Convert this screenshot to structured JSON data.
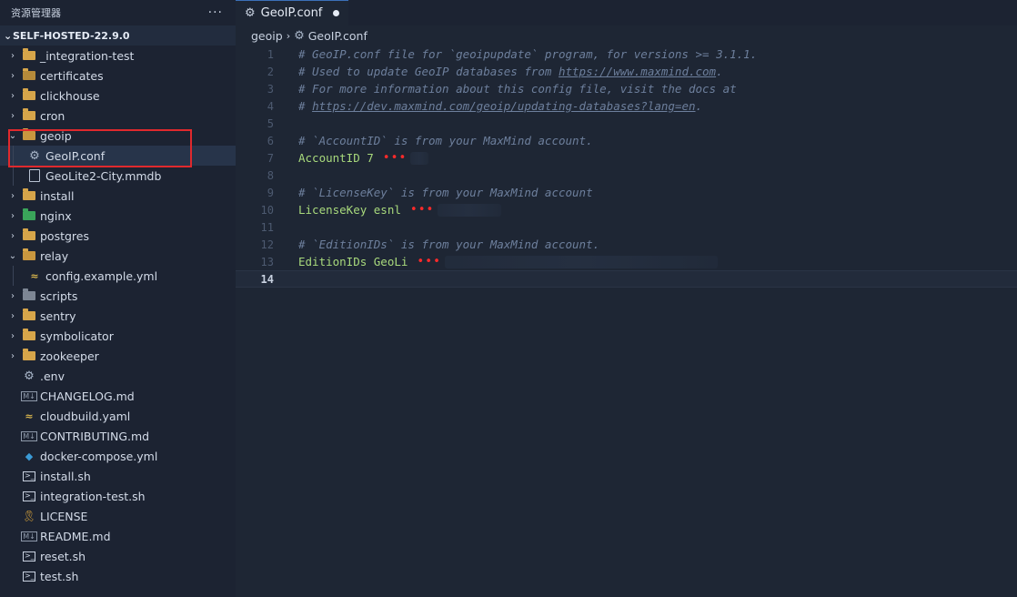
{
  "sidebar": {
    "title": "资源管理器",
    "more": "···",
    "root": "SELF-HOSTED-22.9.0",
    "items": [
      {
        "label": "_integration-test",
        "type": "folder",
        "depth": 0,
        "chev": "›"
      },
      {
        "label": "certificates",
        "type": "folder-cert",
        "depth": 0,
        "chev": "›"
      },
      {
        "label": "clickhouse",
        "type": "folder",
        "depth": 0,
        "chev": "›"
      },
      {
        "label": "cron",
        "type": "folder",
        "depth": 0,
        "chev": "›"
      },
      {
        "label": "geoip",
        "type": "folder-open",
        "depth": 0,
        "chev": "⌄"
      },
      {
        "label": "GeoIP.conf",
        "type": "gear",
        "depth": 1,
        "chev": ""
      },
      {
        "label": "GeoLite2-City.mmdb",
        "type": "doc",
        "depth": 1,
        "chev": ""
      },
      {
        "label": "install",
        "type": "folder",
        "depth": 0,
        "chev": "›"
      },
      {
        "label": "nginx",
        "type": "folder-nginx",
        "depth": 0,
        "chev": "›"
      },
      {
        "label": "postgres",
        "type": "folder",
        "depth": 0,
        "chev": "›"
      },
      {
        "label": "relay",
        "type": "folder-open",
        "depth": 0,
        "chev": "⌄"
      },
      {
        "label": "config.example.yml",
        "type": "yml",
        "depth": 1,
        "chev": ""
      },
      {
        "label": "scripts",
        "type": "folder-scripts",
        "depth": 0,
        "chev": "›"
      },
      {
        "label": "sentry",
        "type": "folder",
        "depth": 0,
        "chev": "›"
      },
      {
        "label": "symbolicator",
        "type": "folder",
        "depth": 0,
        "chev": "›"
      },
      {
        "label": "zookeeper",
        "type": "folder",
        "depth": 0,
        "chev": "›"
      },
      {
        "label": ".env",
        "type": "gear",
        "depth": 0,
        "chev": ""
      },
      {
        "label": "CHANGELOG.md",
        "type": "md",
        "depth": 0,
        "chev": ""
      },
      {
        "label": "cloudbuild.yaml",
        "type": "yml",
        "depth": 0,
        "chev": ""
      },
      {
        "label": "CONTRIBUTING.md",
        "type": "md",
        "depth": 0,
        "chev": ""
      },
      {
        "label": "docker-compose.yml",
        "type": "docker",
        "depth": 0,
        "chev": ""
      },
      {
        "label": "install.sh",
        "type": "sh",
        "depth": 0,
        "chev": ""
      },
      {
        "label": "integration-test.sh",
        "type": "sh",
        "depth": 0,
        "chev": ""
      },
      {
        "label": "LICENSE",
        "type": "license",
        "depth": 0,
        "chev": ""
      },
      {
        "label": "README.md",
        "type": "md",
        "depth": 0,
        "chev": ""
      },
      {
        "label": "reset.sh",
        "type": "sh",
        "depth": 0,
        "chev": ""
      },
      {
        "label": "test.sh",
        "type": "sh",
        "depth": 0,
        "chev": ""
      }
    ],
    "selected_index": 5
  },
  "editor": {
    "tab": {
      "label": "GeoIP.conf",
      "modified": true
    },
    "breadcrumb": {
      "folder": "geoip",
      "separator": "›",
      "file": "GeoIP.conf"
    },
    "current_line": 14,
    "lines": [
      {
        "n": "1",
        "kind": "comment",
        "text": "# GeoIP.conf file for `geoipupdate` program, for versions >= 3.1.1."
      },
      {
        "n": "2",
        "kind": "comment-link",
        "pre": "# Used to update GeoIP databases from ",
        "link": "https://www.maxmind.com",
        "post": "."
      },
      {
        "n": "3",
        "kind": "comment",
        "text": "# For more information about this config file, visit the docs at"
      },
      {
        "n": "4",
        "kind": "comment-link",
        "pre": "# ",
        "link": "https://dev.maxmind.com/geoip/updating-databases?lang=en",
        "post": "."
      },
      {
        "n": "5",
        "kind": "blank",
        "text": ""
      },
      {
        "n": "6",
        "kind": "comment",
        "text": "# `AccountID` is from your MaxMind account."
      },
      {
        "n": "7",
        "kind": "value",
        "text": "AccountID 7",
        "redacted": "•••"
      },
      {
        "n": "8",
        "kind": "blank",
        "text": ""
      },
      {
        "n": "9",
        "kind": "comment",
        "text": "# `LicenseKey` is from your MaxMind account"
      },
      {
        "n": "10",
        "kind": "value",
        "text": "LicenseKey esnl",
        "redacted": "•••"
      },
      {
        "n": "11",
        "kind": "blank",
        "text": ""
      },
      {
        "n": "12",
        "kind": "comment",
        "text": "# `EditionIDs` is from your MaxMind account."
      },
      {
        "n": "13",
        "kind": "value",
        "text": "EditionIDs GeoLi",
        "redacted": "•••"
      },
      {
        "n": "14",
        "kind": "blank",
        "text": ""
      }
    ]
  },
  "colors": {
    "highlight_box": "#e0292d",
    "folder": "#d6a54a",
    "comment": "#6d7f9c",
    "value": "#a8d97c"
  }
}
